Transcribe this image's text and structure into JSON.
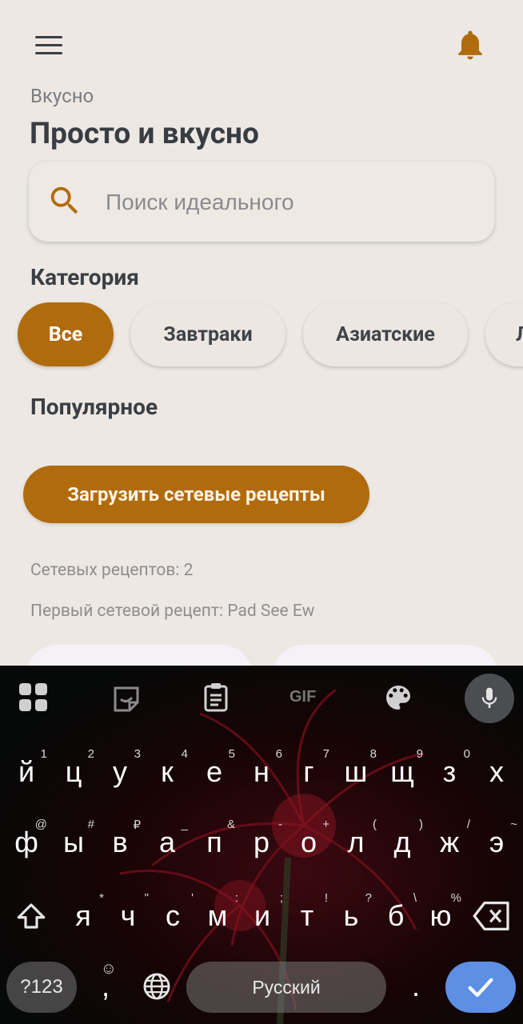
{
  "header": {
    "subtitle": "Вкусно",
    "title": "Просто и вкусно"
  },
  "search": {
    "placeholder": "Поиск идеального"
  },
  "categories": {
    "label": "Категория",
    "items": [
      "Все",
      "Завтраки",
      "Азиатские",
      "Л"
    ],
    "selected": "Все"
  },
  "popular": {
    "label": "Популярное",
    "load_button": "Загрузить сетевые рецепты",
    "network_count": "Сетевых рецептов: 2",
    "first_recipe": "Первый сетевой рецепт: Pad See Ew"
  },
  "colors": {
    "accent": "#b06b0c",
    "background": "#ede8e3",
    "text": "#3a3f45"
  },
  "keyboard": {
    "toolbar_icons": [
      "apps-grid-icon",
      "sticker-icon",
      "clipboard-icon",
      "gif-icon",
      "palette-icon",
      "mic-icon"
    ],
    "gif_label": "GIF",
    "row1": [
      {
        "key": "й",
        "hint": "1"
      },
      {
        "key": "ц",
        "hint": "2"
      },
      {
        "key": "у",
        "hint": "3"
      },
      {
        "key": "к",
        "hint": "4"
      },
      {
        "key": "е",
        "hint": "5"
      },
      {
        "key": "н",
        "hint": "6"
      },
      {
        "key": "г",
        "hint": "7"
      },
      {
        "key": "ш",
        "hint": "8"
      },
      {
        "key": "щ",
        "hint": "9"
      },
      {
        "key": "з",
        "hint": "0"
      },
      {
        "key": "х",
        "hint": ""
      }
    ],
    "row2": [
      {
        "key": "ф",
        "hint": "@"
      },
      {
        "key": "ы",
        "hint": "#"
      },
      {
        "key": "в",
        "hint": "₽"
      },
      {
        "key": "а",
        "hint": "_"
      },
      {
        "key": "п",
        "hint": "&"
      },
      {
        "key": "р",
        "hint": "-"
      },
      {
        "key": "о",
        "hint": "+"
      },
      {
        "key": "л",
        "hint": "("
      },
      {
        "key": "д",
        "hint": ")"
      },
      {
        "key": "ж",
        "hint": "/"
      },
      {
        "key": "э",
        "hint": "~"
      }
    ],
    "row3": [
      {
        "key": "я",
        "hint": "*"
      },
      {
        "key": "ч",
        "hint": "\""
      },
      {
        "key": "с",
        "hint": "'"
      },
      {
        "key": "м",
        "hint": ":"
      },
      {
        "key": "и",
        "hint": ";"
      },
      {
        "key": "т",
        "hint": "!"
      },
      {
        "key": "ь",
        "hint": "?"
      },
      {
        "key": "б",
        "hint": "\\"
      },
      {
        "key": "ю",
        "hint": "%"
      }
    ],
    "symbols_key": "?123",
    "emoji_hint": "☺",
    "comma_key": ",",
    "space_label": "Русский",
    "period_key": "."
  }
}
